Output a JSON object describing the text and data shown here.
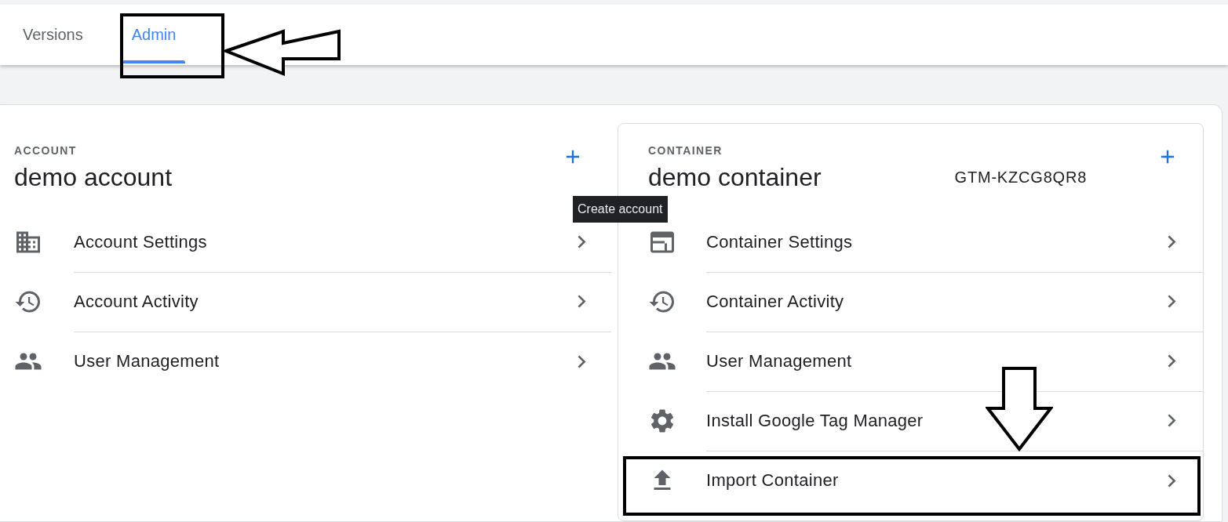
{
  "tabs": [
    {
      "label": "Versions",
      "selected": false
    },
    {
      "label": "Admin",
      "selected": true
    }
  ],
  "account": {
    "section_label": "ACCOUNT",
    "name": "demo account",
    "add_tooltip": "Create account",
    "items": [
      {
        "kind": "settings",
        "label": "Account Settings"
      },
      {
        "kind": "activity",
        "label": "Account Activity"
      },
      {
        "kind": "users",
        "label": "User Management"
      }
    ]
  },
  "container": {
    "section_label": "CONTAINER",
    "name": "demo container",
    "container_id": "GTM-KZCG8QR8",
    "items": [
      {
        "kind": "container-settings",
        "label": "Container Settings"
      },
      {
        "kind": "activity",
        "label": "Container Activity"
      },
      {
        "kind": "users",
        "label": "User Management"
      },
      {
        "kind": "install",
        "label": "Install Google Tag Manager"
      },
      {
        "kind": "import",
        "label": "Import Container"
      }
    ]
  }
}
